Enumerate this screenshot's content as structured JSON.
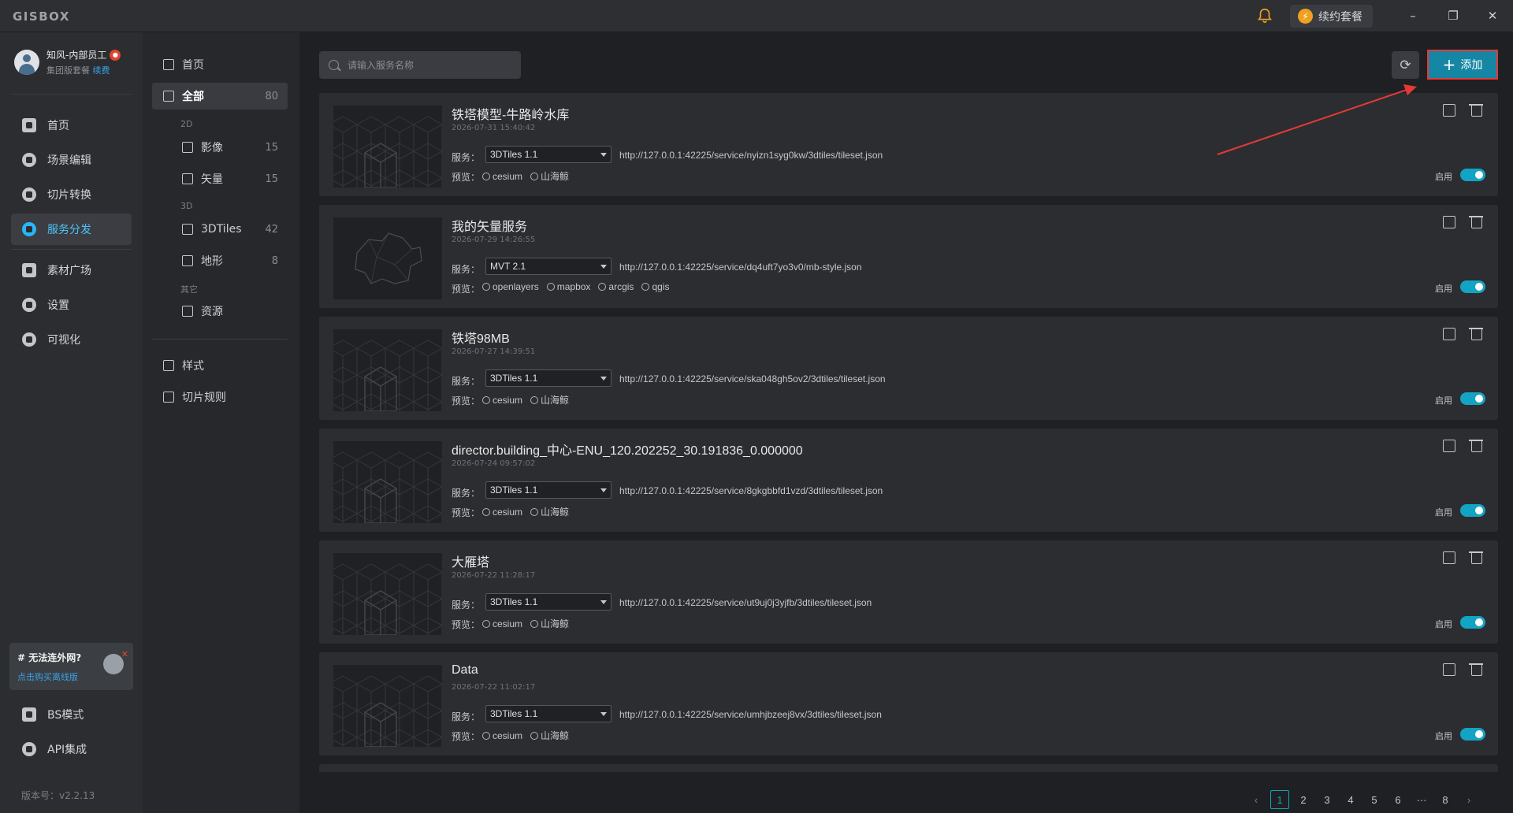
{
  "app": {
    "logo": "GISBOX"
  },
  "titlebar": {
    "renew_label": "续约套餐",
    "minimize": "–",
    "restore": "❐",
    "close": "✕"
  },
  "user": {
    "name": "知风-内部员工",
    "plan": "集团版套餐",
    "renew_link": "续费"
  },
  "nav": {
    "items": [
      {
        "label": "首页",
        "icon": "home-icon"
      },
      {
        "label": "场景编辑",
        "icon": "cube-icon"
      },
      {
        "label": "切片转换",
        "icon": "convert-icon"
      },
      {
        "label": "服务分发",
        "icon": "upload-icon",
        "active": true
      },
      {
        "label": "素材广场",
        "icon": "image-icon"
      },
      {
        "label": "设置",
        "icon": "gear-icon"
      },
      {
        "label": "可视化",
        "icon": "chart-icon"
      }
    ],
    "bottom": [
      {
        "label": "BS模式",
        "icon": "code-icon"
      },
      {
        "label": "API集成",
        "icon": "api-icon"
      }
    ],
    "promo": {
      "title": "# 无法连外网?",
      "link": "点击购买离线版"
    },
    "version": "版本号：v2.2.13"
  },
  "subnav": {
    "home": "首页",
    "all": {
      "label": "全部",
      "count": "80"
    },
    "group_2d": "2D",
    "imagery": {
      "label": "影像",
      "count": "15"
    },
    "vector": {
      "label": "矢量",
      "count": "15"
    },
    "group_3d": "3D",
    "tiles3d": {
      "label": "3DTiles",
      "count": "42"
    },
    "terrain": {
      "label": "地形",
      "count": "8"
    },
    "group_other": "其它",
    "resource": {
      "label": "资源"
    },
    "style": "样式",
    "tile_rules": "切片规则"
  },
  "toolbar": {
    "search_placeholder": "请输入服务名称",
    "add_label": "添加"
  },
  "labels": {
    "service": "服务：",
    "preview": "预览：",
    "enable": "启用"
  },
  "services": [
    {
      "name": "铁塔模型-牛路岭水库",
      "date": "2026-07-31 15:40:42",
      "type": "3DTiles 1.1",
      "url": "http://127.0.0.1:42225/service/nyizn1syg0kw/3dtiles/tileset.json",
      "previews": [
        "cesium",
        "山海鲸"
      ],
      "thumb": "building",
      "enabled": true
    },
    {
      "name": "我的矢量服务",
      "date": "2026-07-29 14:26:55",
      "type": "MVT 2.1",
      "url": "http://127.0.0.1:42225/service/dq4uft7yo3v0/mb-style.json",
      "previews": [
        "openlayers",
        "mapbox",
        "arcgis",
        "qgis"
      ],
      "thumb": "map",
      "enabled": true
    },
    {
      "name": "铁塔98MB",
      "date": "2026-07-27 14:39:51",
      "type": "3DTiles 1.1",
      "url": "http://127.0.0.1:42225/service/ska048gh5ov2/3dtiles/tileset.json",
      "previews": [
        "cesium",
        "山海鲸"
      ],
      "thumb": "building",
      "enabled": true
    },
    {
      "name": "director.building_中心-ENU_120.202252_30.191836_0.000000",
      "date": "2026-07-24 09:57:02",
      "type": "3DTiles 1.1",
      "url": "http://127.0.0.1:42225/service/8gkgbbfd1vzd/3dtiles/tileset.json",
      "previews": [
        "cesium",
        "山海鲸"
      ],
      "thumb": "building",
      "enabled": true
    },
    {
      "name": "大雁塔",
      "date": "2026-07-22 11:28:17",
      "type": "3DTiles 1.1",
      "url": "http://127.0.0.1:42225/service/ut9uj0j3yjfb/3dtiles/tileset.json",
      "previews": [
        "cesium",
        "山海鲸"
      ],
      "thumb": "building",
      "enabled": true
    },
    {
      "name": "Data",
      "date": "2026-07-22 11:02:17",
      "type": "3DTiles 1.1",
      "url": "http://127.0.0.1:42225/service/umhjbzeej8vx/3dtiles/tileset.json",
      "previews": [
        "cesium",
        "山海鲸"
      ],
      "thumb": "building",
      "enabled": true
    }
  ],
  "pagination": {
    "prev": "‹",
    "pages": [
      "1",
      "2",
      "3",
      "4",
      "5",
      "6",
      "···",
      "8"
    ],
    "current": "1",
    "next": "›"
  },
  "colors": {
    "accent": "#13a3c4",
    "add_button": "#1586a3",
    "highlight_border": "#e53935",
    "annotation_arrow": "#e53935"
  }
}
